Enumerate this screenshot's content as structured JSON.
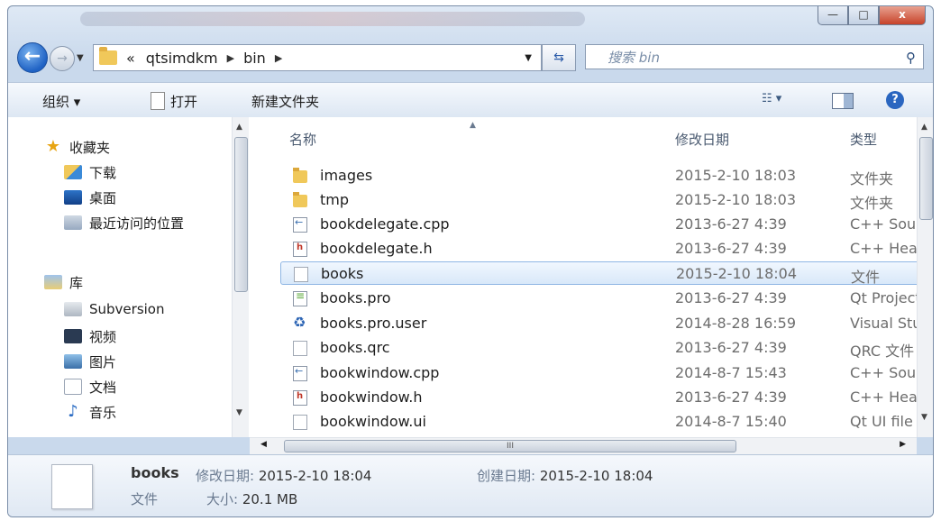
{
  "window": {
    "controls": {
      "minimize": "—",
      "maximize": "□",
      "close": "x"
    }
  },
  "nav": {
    "back": "←",
    "forward": "→",
    "address_prefix": "«",
    "path": [
      "qtsimdkm",
      "bin"
    ],
    "search_placeholder": "搜索 bin"
  },
  "toolbar": {
    "organize": "组织 ▾",
    "open": "打开",
    "new_folder": "新建文件夹",
    "view": "☷ ▾"
  },
  "sidebar": {
    "favorites": {
      "label": "收藏夹",
      "items": [
        "下载",
        "桌面",
        "最近访问的位置"
      ]
    },
    "libraries": {
      "label": "库",
      "items": [
        "Subversion",
        "视频",
        "图片",
        "文档",
        "音乐"
      ]
    }
  },
  "columns": {
    "name": "名称",
    "date": "修改日期",
    "type": "类型"
  },
  "files": [
    {
      "name": "images",
      "date": "2015-2-10 18:03",
      "type": "文件夹",
      "icon": "folder-icon"
    },
    {
      "name": "tmp",
      "date": "2015-2-10 18:03",
      "type": "文件夹",
      "icon": "folder-icon"
    },
    {
      "name": "bookdelegate.cpp",
      "date": "2013-6-27 4:39",
      "type": "C++ Source",
      "icon": "cpp-file-icon"
    },
    {
      "name": "bookdelegate.h",
      "date": "2013-6-27 4:39",
      "type": "C++ Header",
      "icon": "header-file-icon"
    },
    {
      "name": "books",
      "date": "2015-2-10 18:04",
      "type": "文件",
      "icon": "blank-file-icon",
      "selected": true
    },
    {
      "name": "books.pro",
      "date": "2013-6-27 4:39",
      "type": "Qt Project",
      "icon": "pro-file-icon"
    },
    {
      "name": "books.pro.user",
      "date": "2014-8-28 16:59",
      "type": "Visual Studio",
      "icon": "user-file-icon"
    },
    {
      "name": "books.qrc",
      "date": "2013-6-27 4:39",
      "type": "QRC 文件",
      "icon": "blank-file-icon"
    },
    {
      "name": "bookwindow.cpp",
      "date": "2014-8-7 15:43",
      "type": "C++ Source",
      "icon": "cpp-file-icon"
    },
    {
      "name": "bookwindow.h",
      "date": "2013-6-27 4:39",
      "type": "C++ Header",
      "icon": "header-file-icon"
    },
    {
      "name": "bookwindow.ui",
      "date": "2014-8-7 15:40",
      "type": "Qt UI file",
      "icon": "blank-file-icon"
    }
  ],
  "details": {
    "name": "books",
    "modified_label": "修改日期:",
    "modified": "2015-2-10 18:04",
    "created_label": "创建日期:",
    "created": "2015-2-10 18:04",
    "type": "文件",
    "size_label": "大小:",
    "size": "20.1 MB"
  },
  "colors": {
    "selection": "#d8e8f9",
    "accent": "#1f62c4"
  }
}
